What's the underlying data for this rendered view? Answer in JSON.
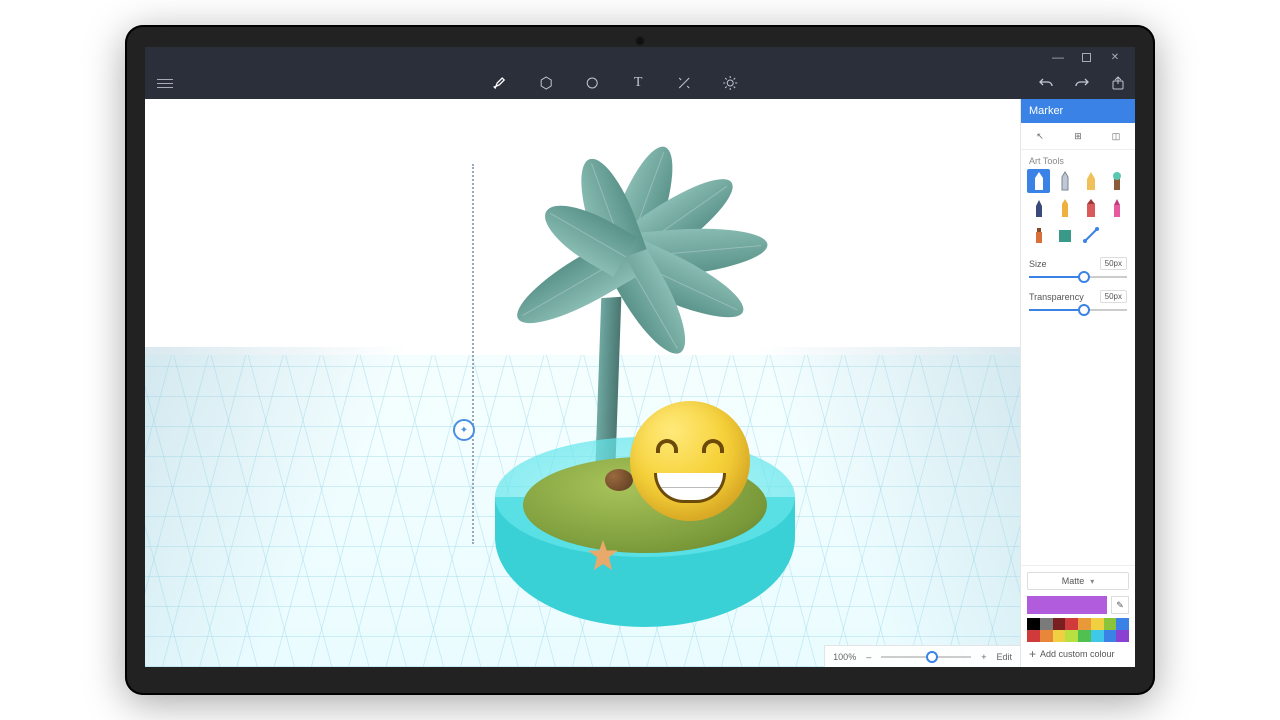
{
  "window": {
    "minimize": "—",
    "maximize": "▢",
    "close": "✕"
  },
  "toolbar": {
    "tools": [
      "brush",
      "3d-shapes",
      "stickers",
      "text",
      "effects",
      "lighting"
    ],
    "right": [
      "undo",
      "redo",
      "share"
    ]
  },
  "panel": {
    "title": "Marker",
    "modes": [
      "cursor",
      "2d-grid",
      "3d-shape"
    ],
    "art_tools_label": "Art Tools",
    "tool_names": [
      "marker",
      "pencil",
      "calligraphy-pen",
      "oil-brush",
      "pen",
      "crayon",
      "fat-marker",
      "highlighter",
      "spray-can",
      "fill",
      "fill-bucket",
      "line"
    ],
    "size": {
      "label": "Size",
      "value": "50px"
    },
    "transparency": {
      "label": "Transparency",
      "value": "50px"
    },
    "finish": "Matte",
    "add_color": "Add custom colour",
    "swatches": [
      "#000000",
      "#7a7a7a",
      "#7a1f1f",
      "#d03a3a",
      "#e89a3a",
      "#f0d040",
      "#8ac43a",
      "#3a82e6",
      "#d03a3a",
      "#e8863a",
      "#f0d040",
      "#b8e040",
      "#50c050",
      "#40c8e8",
      "#3a82e6",
      "#8a40d0"
    ],
    "current_color": "#b05cdc"
  },
  "footer": {
    "zoom": "100%",
    "minus": "–",
    "plus": "+",
    "edit": "Edit"
  }
}
